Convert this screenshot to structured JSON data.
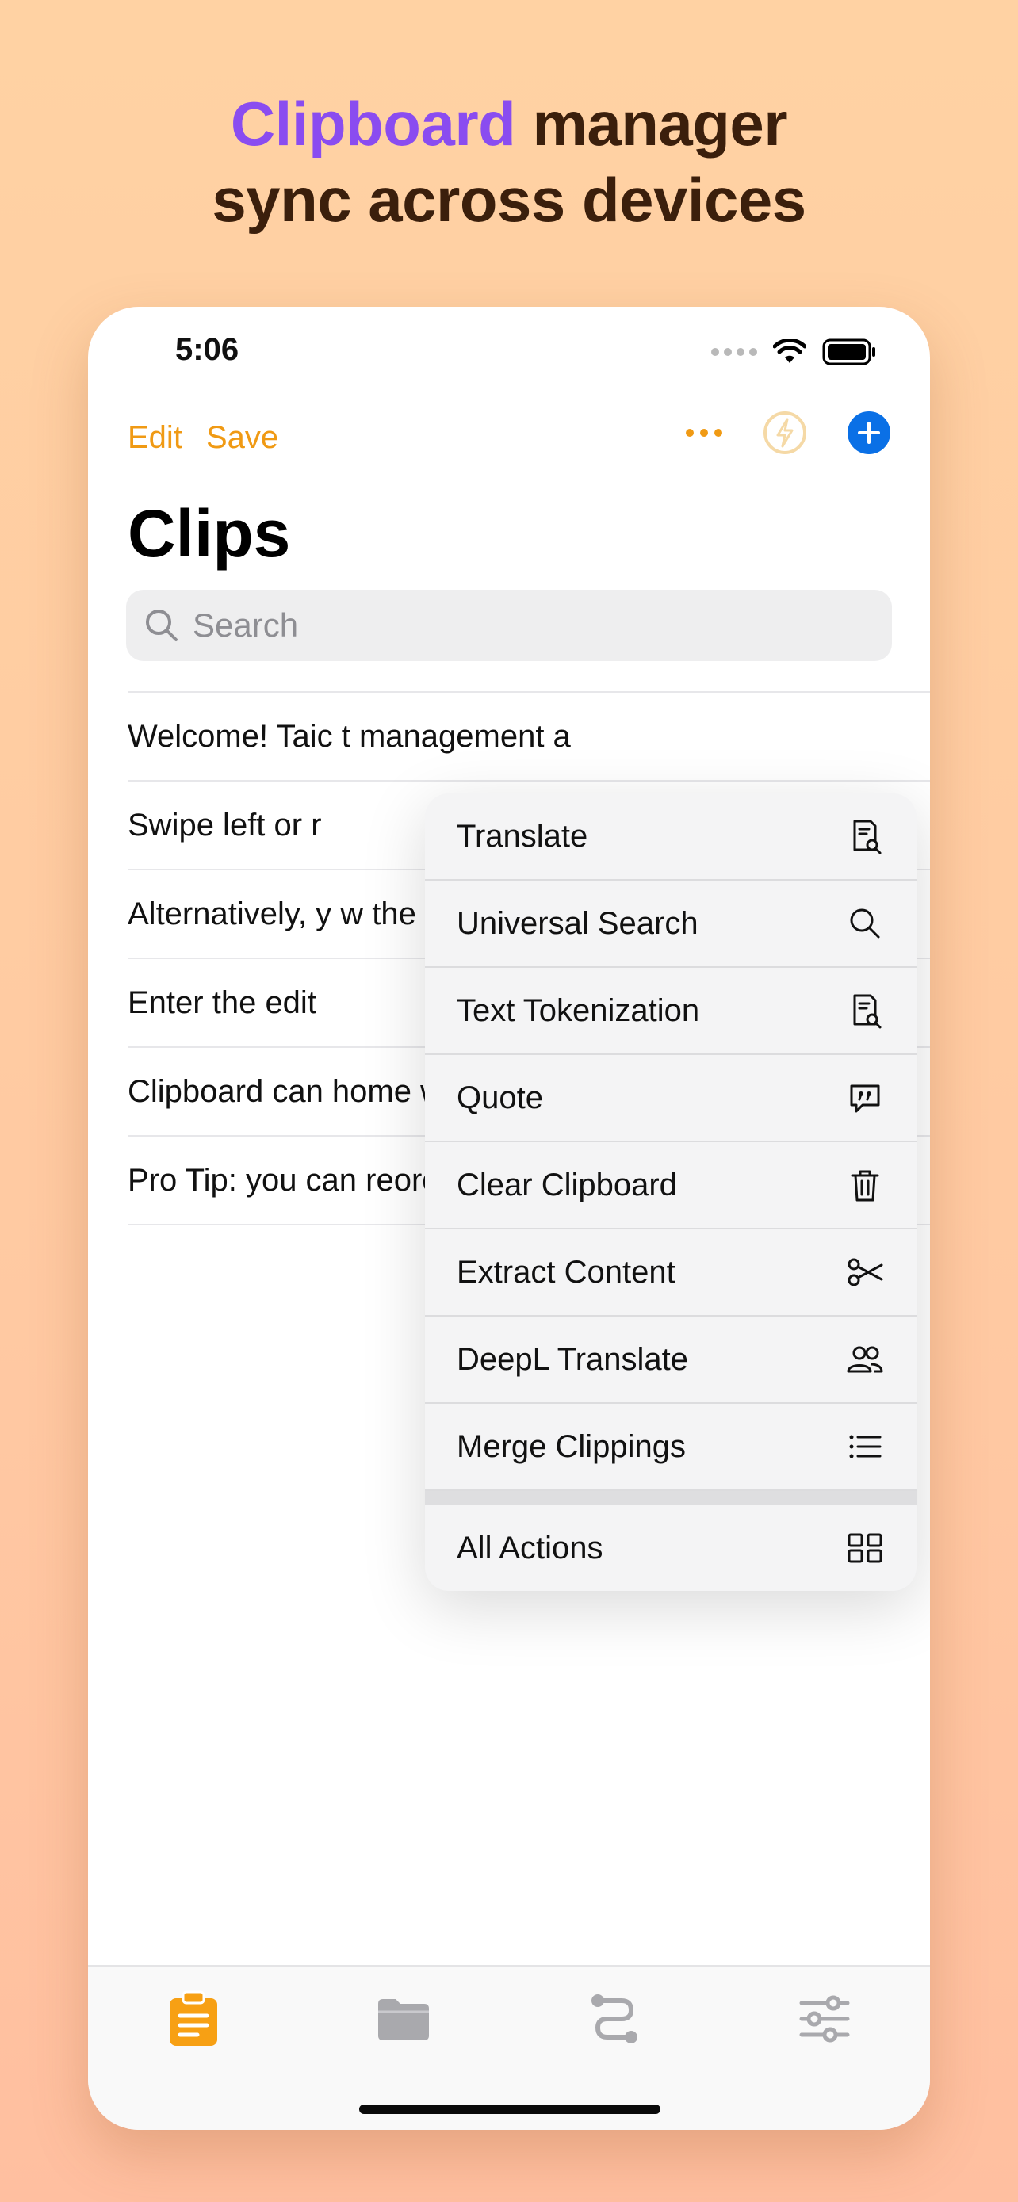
{
  "headline": {
    "accent": "Clipboard",
    "rest1": " manager",
    "line2": "sync across devices"
  },
  "status": {
    "time": "5:06"
  },
  "nav": {
    "edit": "Edit",
    "save": "Save"
  },
  "page_title": "Clips",
  "search": {
    "placeholder": "Search"
  },
  "clips": [
    "Welcome! Taic                                           t management a",
    "Swipe left or r",
    "Alternatively, y                                                w the menu",
    "Enter the edit",
    "Clipboard can home widget",
    "Pro Tip: you can reorder items by using Drag & Drop"
  ],
  "menu": {
    "items": [
      {
        "label": "Translate",
        "icon": "doc-magnify-icon"
      },
      {
        "label": "Universal Search",
        "icon": "search-icon"
      },
      {
        "label": "Text Tokenization",
        "icon": "doc-magnify-icon"
      },
      {
        "label": "Quote",
        "icon": "quote-bubble-icon"
      },
      {
        "label": "Clear Clipboard",
        "icon": "trash-icon"
      },
      {
        "label": "Extract Content",
        "icon": "scissors-icon"
      },
      {
        "label": "DeepL Translate",
        "icon": "people-icon"
      },
      {
        "label": "Merge Clippings",
        "icon": "list-icon"
      }
    ],
    "all_actions": {
      "label": "All Actions",
      "icon": "grid-icon"
    }
  },
  "colors": {
    "accent_orange": "#f09a14",
    "accent_purple": "#8a4cf0",
    "blue": "#0a70e6"
  }
}
